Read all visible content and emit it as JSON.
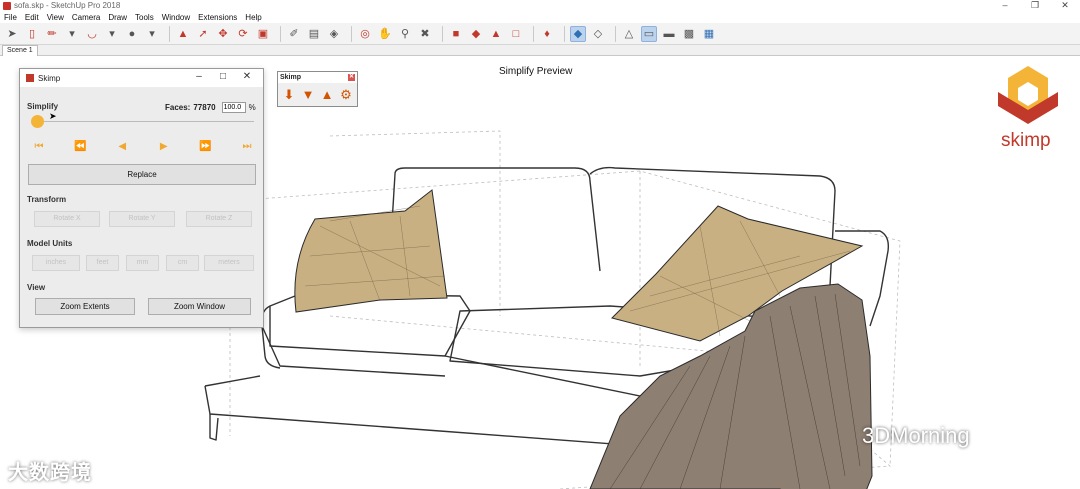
{
  "window": {
    "title": "sofa.skp - SketchUp Pro 2018"
  },
  "menu": [
    "File",
    "Edit",
    "View",
    "Camera",
    "Draw",
    "Tools",
    "Window",
    "Extensions",
    "Help"
  ],
  "scene_tab": "Scene 1",
  "viewport": {
    "title": "Simplify Preview"
  },
  "skimp_toolbar": {
    "title": "Skimp"
  },
  "dialog": {
    "title": "Skimp",
    "simplify_label": "Simplify",
    "faces_label": "Faces:",
    "faces_value": "77870",
    "percent_value": "100.0",
    "percent_sign": "%",
    "slider_fraction": 0.0,
    "replace_label": "Replace",
    "transform_label": "Transform",
    "rotate_x": "Rotate X",
    "rotate_y": "Rotate Y",
    "rotate_z": "Rotate Z",
    "model_units_label": "Model Units",
    "units": [
      "inches",
      "feet",
      "mm",
      "cm",
      "meters"
    ],
    "view_label": "View",
    "zoom_extents": "Zoom Extents",
    "zoom_window": "Zoom Window"
  },
  "brand": {
    "name": "skimp",
    "color": "#c0392b",
    "accent": "#f4b437"
  },
  "watermarks": {
    "left": "大数跨境",
    "right": "3DMorning"
  }
}
